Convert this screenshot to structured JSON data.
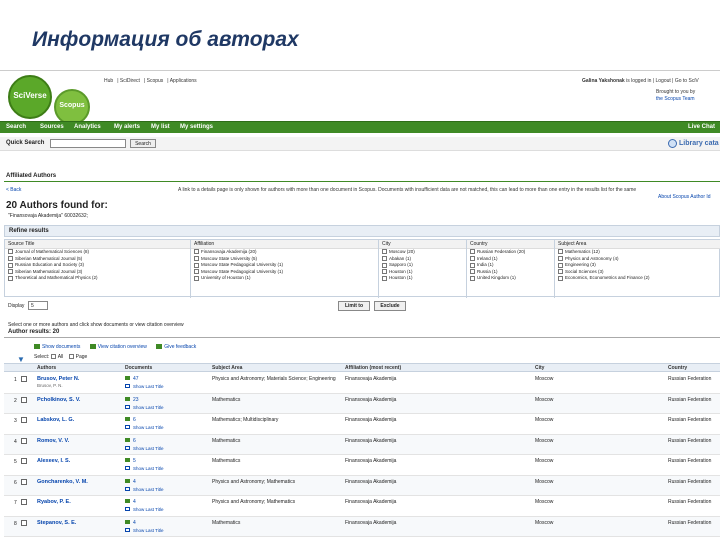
{
  "slide": {
    "title": "Информация об авторах"
  },
  "header": {
    "logo_sciverse": "SciVerse",
    "logo_scopus": "Scopus",
    "top_links": [
      "Hub",
      "SciDirect",
      "Scopus",
      "Applications"
    ],
    "logged_in_user": "Galina Yakshonak",
    "logged_in_suffix": "is logged in",
    "logout": "Logout",
    "go_to": "Go to SciV",
    "brought_by_1": "Brought to you by",
    "brought_by_2": "the Scopus Team"
  },
  "nav": {
    "items": [
      "Search",
      "Sources",
      "Analytics",
      "My alerts",
      "My list",
      "My settings"
    ],
    "live_chat": "Live Chat"
  },
  "quick_search": {
    "label": "Quick Search",
    "button": "Search",
    "value": ""
  },
  "library": {
    "label": "Library cata"
  },
  "page": {
    "section_title": "Affiliated Authors",
    "back": "< Back",
    "info": "A link to a details page is only shown for authors with more than one document in Scopus. Documents with insufficient data are not matched, this can lead to more than one entry in the results list for the same",
    "about": "About Scopus Author Id",
    "found_heading": "20 Authors found for:",
    "query": "\"Finansovaja Akademija\" 60032632;"
  },
  "refine": {
    "heading": "Refine results",
    "columns": [
      {
        "title": "Source Title",
        "items": [
          "Journal of Mathematical Sciences (8)",
          "Siberian Mathematical Journal (5)",
          "Russian Education and Society (3)",
          "Siberian Mathematical Journal (3)",
          "Theoretical and Mathematical Physics (2)"
        ]
      },
      {
        "title": "Affiliation",
        "items": [
          "Finansovaja Akademija (20)",
          "Moscow State University (5)",
          "Moscow State Pedagogical University (1)",
          "Moscow State Pedagogical University (1)",
          "University of Houston (1)"
        ]
      },
      {
        "title": "City",
        "items": [
          "Moscow (20)",
          "Abakan (1)",
          "Sapporo (1)",
          "Houston (1)",
          "Houston (1)"
        ]
      },
      {
        "title": "Country",
        "items": [
          "Russian Federation (20)",
          "Ireland (1)",
          "India (1)",
          "Russia (1)",
          "United Kingdom (1)"
        ]
      },
      {
        "title": "Subject Area",
        "items": [
          "Mathematics (12)",
          "Physics and Astronomy (4)",
          "Engineering (3)",
          "Social Sciences (3)",
          "Economics, Econometrics and Finance (2)"
        ]
      }
    ],
    "display_label": "Display",
    "display_value": "5",
    "limit_button": "Limit to",
    "exclude_button": "Exclude"
  },
  "results": {
    "select_info": "Select one or more authors and click show documents or view citation overview",
    "heading": "Author results: 20",
    "tools": [
      "Show documents",
      "View citation overview",
      "Give feedback"
    ],
    "select_label": "Select:",
    "all_label": "All",
    "page_label": "Page",
    "columns": [
      "Authors",
      "Documents",
      "Subject Area",
      "Affiliation (most recent)",
      "City",
      "Country"
    ],
    "show_last_title": "Show Last Title",
    "rows": [
      {
        "num": "1",
        "name": "Brusov, Peter N.",
        "alt": "Brusov, P. N.",
        "docs": "47",
        "subject": "Physics and Astronomy; Materials Science; Engineering",
        "affiliation": "Finansovaja Akademija",
        "city": "Moscow",
        "country": "Russian Federation"
      },
      {
        "num": "2",
        "name": "Pcholkinov, S. V.",
        "alt": "",
        "docs": "23",
        "subject": "Mathematics",
        "affiliation": "Finansovaja Akademija",
        "city": "Moscow",
        "country": "Russian Federation"
      },
      {
        "num": "3",
        "name": "Labskov, L. G.",
        "alt": "",
        "docs": "6",
        "subject": "Mathematics; Multidisciplinary",
        "affiliation": "Finansovaja Akademija",
        "city": "Moscow",
        "country": "Russian Federation"
      },
      {
        "num": "4",
        "name": "Romov, V. V.",
        "alt": "",
        "docs": "6",
        "subject": "Mathematics",
        "affiliation": "Finansovaja Akademija",
        "city": "Moscow",
        "country": "Russian Federation"
      },
      {
        "num": "5",
        "name": "Alexeev, I. S.",
        "alt": "",
        "docs": "5",
        "subject": "Mathematics",
        "affiliation": "Finansovaja Akademija",
        "city": "Moscow",
        "country": "Russian Federation"
      },
      {
        "num": "6",
        "name": "Goncharenko, V. M.",
        "alt": "",
        "docs": "4",
        "subject": "Physics and Astronomy; Mathematics",
        "affiliation": "Finansovaja Akademija",
        "city": "Moscow",
        "country": "Russian Federation"
      },
      {
        "num": "7",
        "name": "Ryabov, P. E.",
        "alt": "",
        "docs": "4",
        "subject": "Physics and Astronomy; Mathematics",
        "affiliation": "Finansovaja Akademija",
        "city": "Moscow",
        "country": "Russian Federation"
      },
      {
        "num": "8",
        "name": "Stepanov, S. E.",
        "alt": "",
        "docs": "4",
        "subject": "Mathematics",
        "affiliation": "Finansovaja Akademija",
        "city": "Moscow",
        "country": "Russian Federation"
      }
    ]
  }
}
